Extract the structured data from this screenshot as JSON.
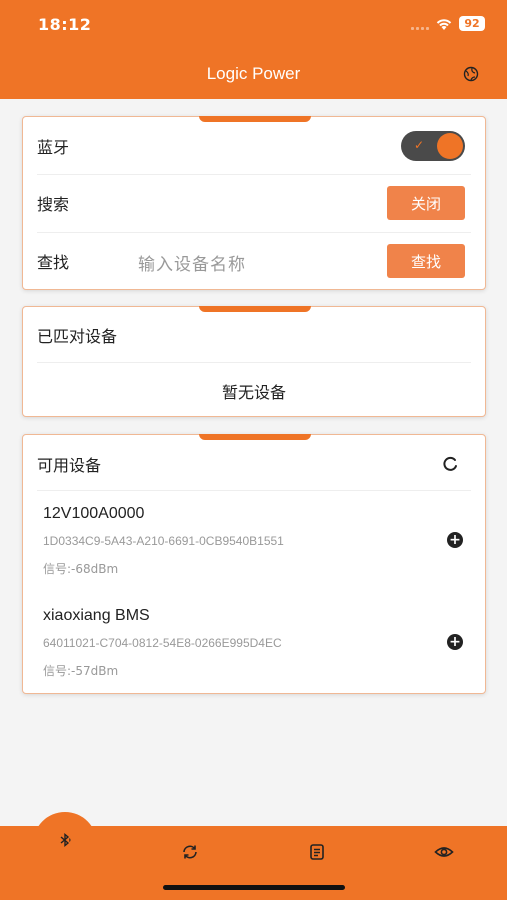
{
  "status": {
    "time": "18:12",
    "battery": "92"
  },
  "header": {
    "title": "Logic Power",
    "globe_icon": "globe-icon"
  },
  "bluetooth_card": {
    "bluetooth_label": "蓝牙",
    "bluetooth_on": true,
    "search_label": "搜索",
    "search_button": "关闭",
    "find_label": "查找",
    "find_placeholder": "输入设备名称",
    "find_button": "查找"
  },
  "paired_card": {
    "title": "已匹对设备",
    "empty_text": "暂无设备"
  },
  "available_card": {
    "title": "可用设备",
    "devices": [
      {
        "name": "12V100A0000",
        "id": "1D0334C9-5A43-A210-6691-0CB9540B1551",
        "signal": "信号:-68dBm"
      },
      {
        "name": "xiaoxiang BMS",
        "id": "64011021-C704-0812-54E8-0266E995D4EC",
        "signal": "信号:-57dBm"
      }
    ]
  },
  "tabbar": {
    "tabs": [
      "bluetooth-icon",
      "sync-icon",
      "document-icon",
      "eye-icon"
    ]
  },
  "colors": {
    "accent": "#ef7426",
    "button": "#f0834a"
  }
}
